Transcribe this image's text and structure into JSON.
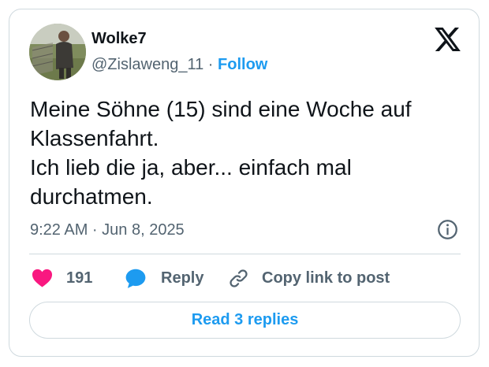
{
  "author": {
    "display_name": "Wolke7",
    "handle": "@Zislaweng_11",
    "separator": "·",
    "follow_label": "Follow"
  },
  "tweet": {
    "lines": [
      "Meine Söhne (15) sind eine Woche auf",
      "Klassenfahrt.",
      "Ich lieb die ja, aber... einfach mal",
      "durchatmen."
    ],
    "timestamp": "9:22 AM · Jun 8, 2025"
  },
  "actions": {
    "like_count": "191",
    "reply_label": "Reply",
    "copy_link_label": "Copy link to post"
  },
  "read_replies_label": "Read 3 replies",
  "icons": {
    "brand": "x-logo-icon",
    "info": "info-icon",
    "like": "heart-icon",
    "reply": "speech-bubble-icon",
    "copy": "link-icon"
  },
  "colors": {
    "link_blue": "#1d9bf0",
    "heart_pink": "#f91880",
    "muted_text": "#536471",
    "border": "#cfd9de"
  }
}
